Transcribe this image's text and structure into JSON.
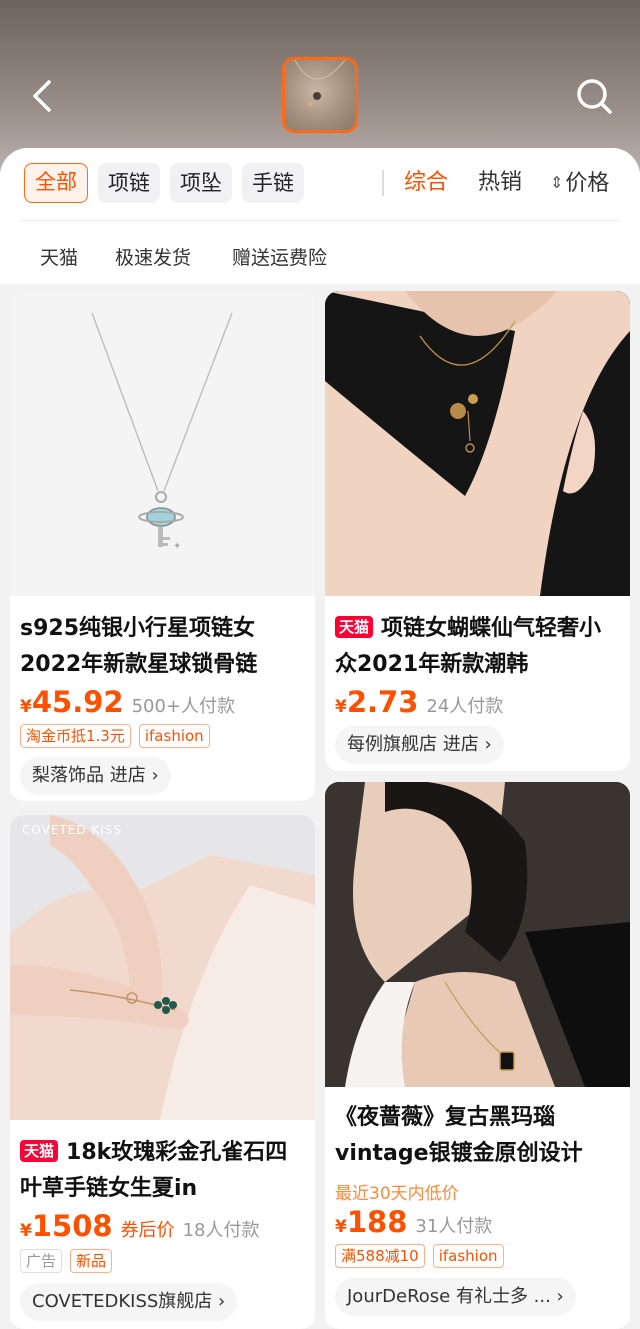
{
  "header": {
    "back_icon": "chevron-left-icon",
    "search_icon": "search-icon"
  },
  "tabs": [
    "全部",
    "项链",
    "项坠",
    "手链"
  ],
  "sort": {
    "overall": "综合",
    "hot": "热销",
    "price": "价格"
  },
  "chips": [
    "天猫",
    "极速发货",
    "赠送运费险"
  ],
  "products": [
    {
      "title": "s925纯银小行星项链女2022年新款星球锁骨链",
      "yen": "¥",
      "price": "45.92",
      "sold": "500+人付款",
      "tags": [
        "淘金币抵1.3元",
        "ifashion"
      ],
      "shop": "梨落饰品 进店 ›"
    },
    {
      "badge": "天猫",
      "title": "项链女蝴蝶仙气轻奢小众2021年新款潮韩",
      "yen": "¥",
      "price": "2.73",
      "sold": "24人付款",
      "shop": "每例旗舰店 进店 ›"
    },
    {
      "image_text": "COVETED KISS",
      "badge": "天猫",
      "title": "18k玫瑰彩金孔雀石四叶草手链女生夏in",
      "yen": "¥",
      "price": "1508",
      "coupon": "券后价",
      "sold": "18人付款",
      "tags": [
        "广告",
        "新品"
      ],
      "shop": "COVETEDKISS旗舰店 ›"
    },
    {
      "title": "《夜蔷薇》复古黑玛瑙vintage银镀金原创设计",
      "low_price": "最近30天内低价",
      "yen": "¥",
      "price": "188",
      "sold": "31人付款",
      "tags": [
        "满588减10",
        "ifashion"
      ],
      "shop": "JourDeRose 有礼士多 ... ›"
    }
  ],
  "colors": {
    "accent": "#ff5000",
    "tmall": "#ff0036",
    "page_bg": "#f2f2f2"
  }
}
